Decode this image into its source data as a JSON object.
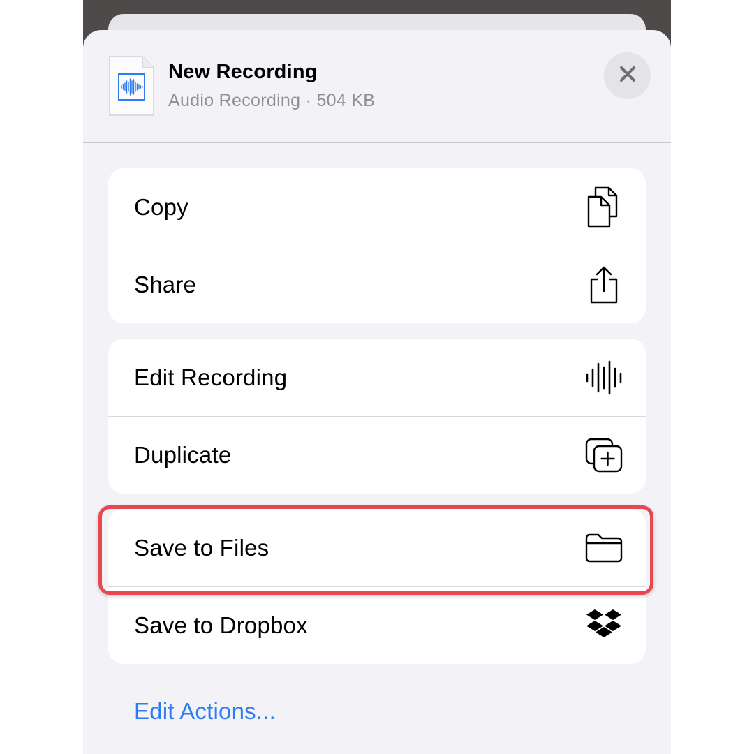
{
  "file": {
    "title": "New Recording",
    "subtitle": "Audio Recording · 504 KB",
    "thumbnail_icon": "waveform-document-icon"
  },
  "header": {
    "close_icon": "close-icon"
  },
  "groups": [
    {
      "items": [
        {
          "label": "Copy",
          "icon": "copy-icon"
        },
        {
          "label": "Share",
          "icon": "share-icon"
        }
      ]
    },
    {
      "items": [
        {
          "label": "Edit Recording",
          "icon": "waveform-icon"
        },
        {
          "label": "Duplicate",
          "icon": "duplicate-icon"
        }
      ]
    },
    {
      "items": [
        {
          "label": "Save to Files",
          "icon": "folder-icon"
        },
        {
          "label": "Save to Dropbox",
          "icon": "dropbox-icon"
        }
      ]
    }
  ],
  "footer": {
    "edit_actions_label": "Edit Actions..."
  },
  "colors": {
    "sheet_background": "#f2f2f7",
    "link_blue": "#2f7bef",
    "highlight_red": "#e8474f",
    "secondary_text": "#8e8e93"
  }
}
